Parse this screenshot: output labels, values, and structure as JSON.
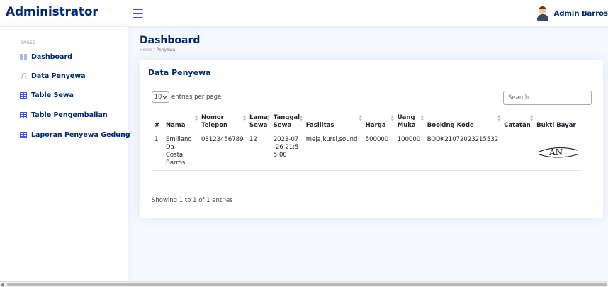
{
  "app": {
    "brand": "Administrator"
  },
  "user": {
    "name": "Admin Barros"
  },
  "sidebar": {
    "heading": "PAGES",
    "items": [
      {
        "label": "Dashboard",
        "icon": "grid-icon"
      },
      {
        "label": "Data Penyewa",
        "icon": "person-icon"
      },
      {
        "label": "Table Sewa",
        "icon": "table-icon"
      },
      {
        "label": "Table Pengembalian",
        "icon": "table-icon"
      },
      {
        "label": "Laporan Penyewa Gedung",
        "icon": "table-icon"
      }
    ]
  },
  "page": {
    "title": "Dashboard",
    "breadcrumb": {
      "home": "Home",
      "separator": "/",
      "current": "Penyewa"
    }
  },
  "card": {
    "title": "Data Penyewa",
    "entries_value": "10",
    "entries_suffix": "entries per page",
    "search_placeholder": "Search...",
    "columns": [
      "#",
      "Nama",
      "Nomor Telepon",
      "Lama Sewa",
      "Tanggal Sewa",
      "Fasilitas",
      "Harga",
      "Uang Muka",
      "Booking Kode",
      "Catatan",
      "Bukti Bayar"
    ],
    "rows": [
      {
        "no": "1",
        "nama": "Emiliano Da Costa Barros",
        "telepon": "08123456789",
        "lama": "12",
        "tanggal": "2023-07-26 21:55:00",
        "fasilitas": "meja,kursi,sound",
        "harga": "500000",
        "uang_muka": "100000",
        "booking": "BOOK21072023215532",
        "catatan": "",
        "bukti_bayar": "AN"
      }
    ],
    "footer": "Showing 1 to 1 of 1 entries"
  },
  "colors": {
    "primary": "#4154f1",
    "heading": "#012970",
    "muted": "#899bbd",
    "background": "#f6f9ff"
  }
}
